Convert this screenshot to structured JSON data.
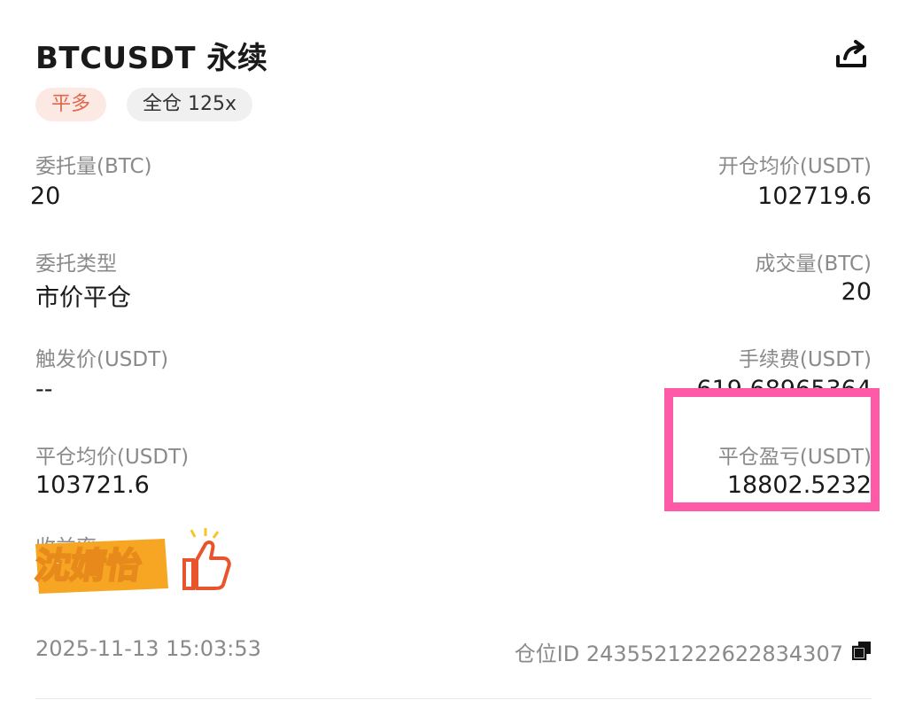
{
  "header": {
    "title": "BTCUSDT 永续",
    "side_badge": "平多",
    "margin_badge": "全仓 125x"
  },
  "fields": {
    "order_qty_label": "委托量(BTC)",
    "order_qty_value": "20",
    "open_avg_label": "开仓均价(USDT)",
    "open_avg_value": "102719.6",
    "order_type_label": "委托类型",
    "order_type_value": "市价平仓",
    "filled_label": "成交量(BTC)",
    "filled_value": "20",
    "trigger_label": "触发价(USDT)",
    "trigger_value": "--",
    "fee_label": "手续费(USDT)",
    "fee_value": "619.68965364",
    "close_avg_label": "平仓均价(USDT)",
    "close_avg_value": "103721.6",
    "close_pnl_label": "平仓盈亏(USDT)",
    "close_pnl_value": "18802.5232",
    "roi_label": "收益率"
  },
  "overlay": {
    "sticker_text": "沈婧怡",
    "highlight_color": "#ff5aa8"
  },
  "footer": {
    "timestamp": "2025-11-13 15:03:53",
    "position_id": "仓位ID 2435521222622834307"
  },
  "icons": {
    "share": "share-icon",
    "copy": "copy-icon",
    "thumb": "thumbs-up-icon"
  }
}
